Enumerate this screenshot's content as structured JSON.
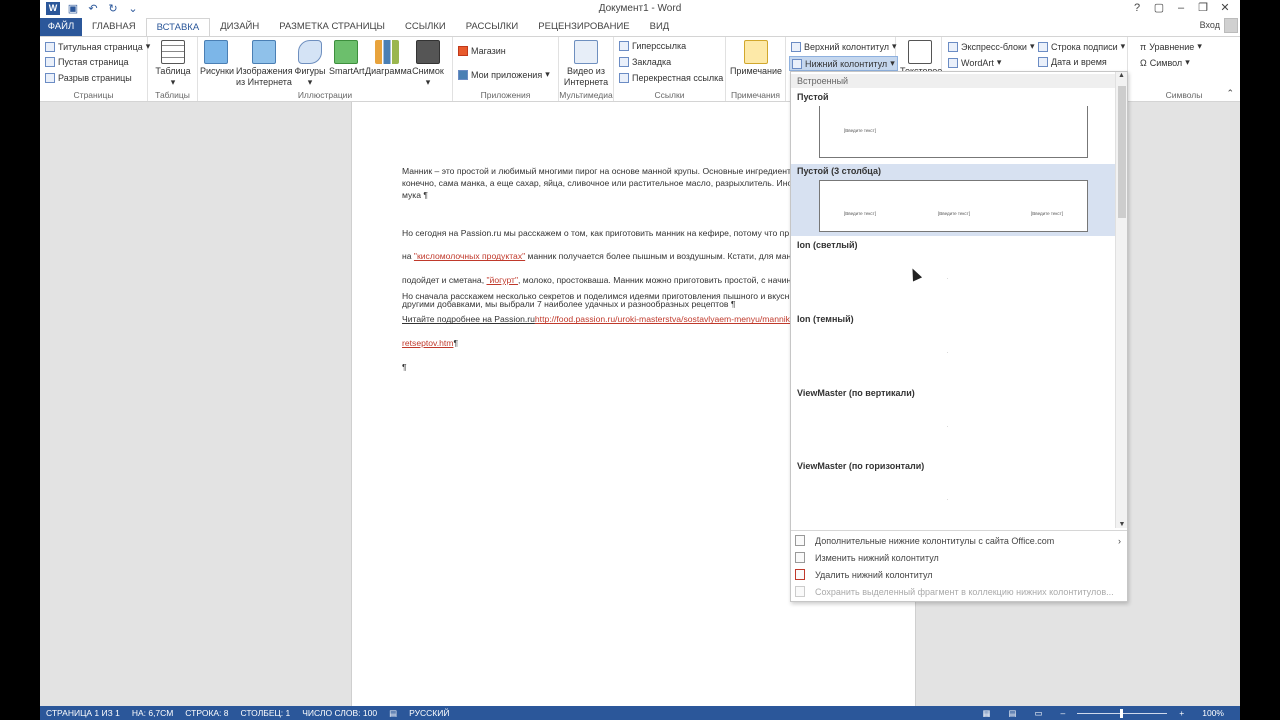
{
  "window": {
    "title": "Документ1 - Word",
    "app_icon": "W",
    "signin": "Вход",
    "qat": [
      "save-icon",
      "undo-icon",
      "redo-icon",
      "customize-icon"
    ],
    "buttons": [
      "?",
      "▢",
      "–",
      "❐",
      "✕"
    ]
  },
  "tabs": [
    {
      "label": "ФАЙЛ"
    },
    {
      "label": "ГЛАВНАЯ"
    },
    {
      "label": "ВСТАВКА"
    },
    {
      "label": "ДИЗАЙН"
    },
    {
      "label": "РАЗМЕТКА СТРАНИЦЫ"
    },
    {
      "label": "ССЫЛКИ"
    },
    {
      "label": "РАССЫЛКИ"
    },
    {
      "label": "РЕЦЕНЗИРОВАНИЕ"
    },
    {
      "label": "ВИД"
    }
  ],
  "ribbon": {
    "pages": {
      "title_page": "Титульная страница",
      "blank_page": "Пустая страница",
      "page_break": "Разрыв страницы",
      "label": "Страницы"
    },
    "tables": {
      "table": "Таблица",
      "label": "Таблицы"
    },
    "illustrations": {
      "pictures": "Рисунки",
      "online1": "Изображения",
      "online2": "из Интернета",
      "shapes": "Фигуры",
      "smartart": "SmartArt",
      "chart": "Диаграмма",
      "screenshot": "Снимок",
      "label": "Иллюстрации"
    },
    "apps": {
      "store": "Магазин",
      "my_apps": "Мои приложения",
      "label": "Приложения"
    },
    "media": {
      "video1": "Видео из",
      "video2": "Интернета",
      "label": "Мультимедиа"
    },
    "links": {
      "hyperlink": "Гиперссылка",
      "bookmark": "Закладка",
      "crossref": "Перекрестная ссылка",
      "label": "Ссылки"
    },
    "comments": {
      "comment": "Примечание",
      "label": "Примечания"
    },
    "header_footer": {
      "header": "Верхний колонтитул",
      "footer": "Нижний колонтитул",
      "textbox": "Текстовое"
    },
    "text": {
      "quick_parts": "Экспресс-блоки",
      "wordart": "WordArt",
      "signature": "Строка подписи",
      "datetime": "Дата и время"
    },
    "symbols": {
      "equation": "Уравнение",
      "symbol": "Символ",
      "label": "Символы"
    }
  },
  "document": {
    "p1": "Манник – это простой и любимый многими пирог на основе манной крупы. Основные ингредиент\nконечно, сама манка, а еще сахар, яйца, сливочное или растительное масло, разрыхлитель. Ино\nмука ¶",
    "p2a": "Но сегодня на Passion.ru мы расскажем о том, как приготовить манник на кефире, потому что пр",
    "p2b_pre": "на ",
    "p2b_link": "\"кисломолочных продуктах\"",
    "p2b_post": " манник получается более пышным и воздушным. Кстати, для манн",
    "p2c_pre": "подойдет и сметана, ",
    "p2c_link": "\"йогурт\"",
    "p2c_post": ", молоко, простокваша. Манник можно приготовить простой, с начинк",
    "p2d": "другими добавками, мы выбрали 7 наиболее удачных и разнообразных рецептов ¶",
    "p3a": "Но сначала расскажем несколько секретов и поделимся идеями приготовления пышного и вкусн",
    "p3b_pre": "Читайте подробнее на Passion.ru",
    "p3b_link": "http://food.passion.ru/uroki-masterstva/sostavlyaem-menyu/mannik",
    "p3c_link": "retseptov.htm",
    "p3c_post": "¶",
    "p4": "¶"
  },
  "gallery": {
    "section": "Встроенный",
    "items": [
      {
        "name": "Пустой",
        "placeholder": "[Введите текст]"
      },
      {
        "name": "Пустой (3 столбца)",
        "placeholder": "[Введите текст]"
      },
      {
        "name": "Ion (светлый)"
      },
      {
        "name": "Ion (темный)"
      },
      {
        "name": "ViewMaster (по вертикали)"
      },
      {
        "name": "ViewMaster (по горизонтали)"
      }
    ],
    "menu": [
      {
        "label": "Дополнительные нижние колонтитулы с сайта Office.com",
        "arrow": "›"
      },
      {
        "label": "Изменить нижний колонтитул"
      },
      {
        "label": "Удалить нижний колонтитул"
      },
      {
        "label": "Сохранить выделенный фрагмент в коллекцию нижних колонтитулов..."
      }
    ]
  },
  "status": {
    "page": "СТРАНИЦА 1 ИЗ 1",
    "position": "НА: 6,7СМ",
    "line": "СТРОКА: 8",
    "column": "СТОЛБЕЦ: 1",
    "words": "ЧИСЛО СЛОВ: 100",
    "language": "РУССКИЙ",
    "zoom": "100%",
    "zoom_minus": "–",
    "zoom_plus": "+"
  },
  "colors": {
    "accent": "#2b579a",
    "link": "#c0392b",
    "selected": "#d7e1f1"
  }
}
